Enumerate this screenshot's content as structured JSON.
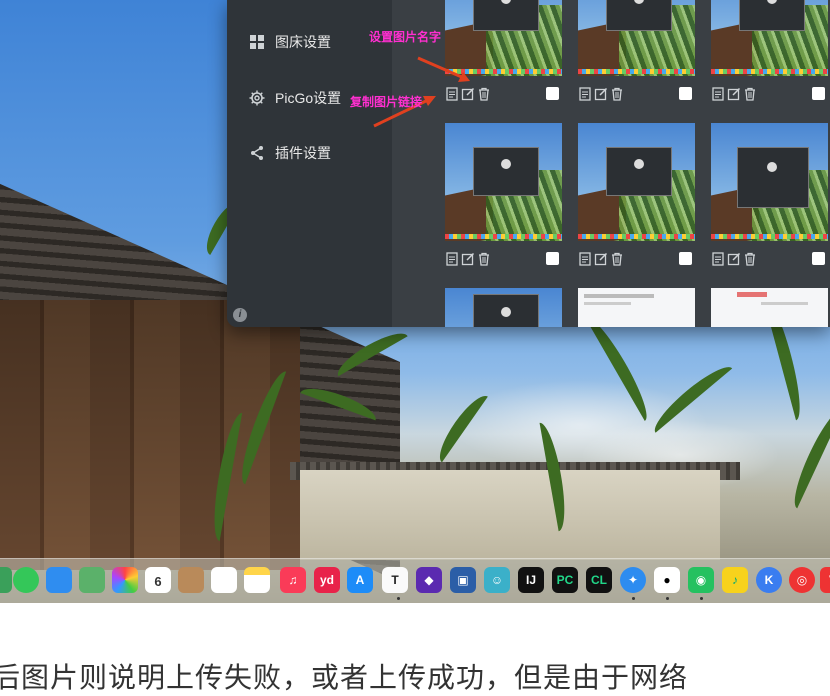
{
  "sidebar": {
    "items": [
      {
        "label": "图床设置",
        "icon": "grid-icon"
      },
      {
        "label": "PicGo设置",
        "icon": "gear-icon"
      },
      {
        "label": "插件设置",
        "icon": "share-icon"
      }
    ],
    "info_icon_label": "i"
  },
  "annotations": {
    "rename": "设置图片名字",
    "copy_link": "复制图片链接"
  },
  "annotation_color": "#ff2fd0",
  "gallery": {
    "item_actions": [
      "copy-link-icon",
      "edit-name-icon",
      "delete-icon"
    ],
    "rows": 3,
    "columns": 3
  },
  "dock": {
    "calendar_day": "6",
    "calendar_month": "10月",
    "labels": {
      "yd": "yd",
      "T": "T",
      "IJ": "IJ",
      "PC": "PC",
      "CL": "CL",
      "K": "K"
    }
  },
  "article": {
    "text": "后图片则说明上传失败，或者上传成功，但是由于网络"
  }
}
